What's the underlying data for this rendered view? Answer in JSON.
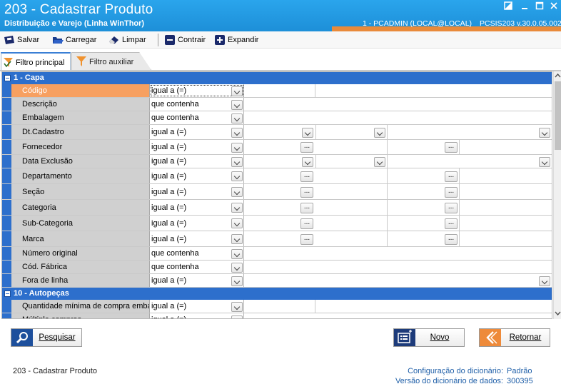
{
  "window": {
    "title": "203 - Cadastrar  Produto",
    "subtitle": "Distribuição e Varejo (Linha WinThor)",
    "user_info": "1 - PCADMIN (LOCAL@LOCAL)",
    "version": "PCSIS203  v.30.0.05.002",
    "accent_color": "#e98a3a",
    "bar_color": "#1d8fd8"
  },
  "toolbar": {
    "salvar": "Salvar",
    "carregar": "Carregar",
    "limpar": "Limpar",
    "contrair": "Contrair",
    "expandir": "Expandir"
  },
  "tabs": {
    "principal": "Filtro principal",
    "auxiliar": "Filtro auxiliar"
  },
  "sections": [
    {
      "title": "1 - Capa"
    },
    {
      "title": "10 - Autopeças"
    }
  ],
  "rows": [
    {
      "label": "Código",
      "operator": "igual a (=)"
    },
    {
      "label": "Descrição",
      "operator": "que contenha"
    },
    {
      "label": "Embalagem",
      "operator": "que contenha"
    },
    {
      "label": "Dt.Cadastro",
      "operator": "igual a (=)"
    },
    {
      "label": "Fornecedor",
      "operator": "igual a (=)"
    },
    {
      "label": "Data Exclusão",
      "operator": "igual a (=)"
    },
    {
      "label": "Departamento",
      "operator": "igual a (=)"
    },
    {
      "label": "Seção",
      "operator": "igual a (=)"
    },
    {
      "label": "Categoria",
      "operator": "igual a (=)"
    },
    {
      "label": "Sub-Categoria",
      "operator": "igual a (=)"
    },
    {
      "label": "Marca",
      "operator": "igual a (=)"
    },
    {
      "label": "Número original",
      "operator": "que contenha"
    },
    {
      "label": "Cód. Fábrica",
      "operator": "que contenha"
    },
    {
      "label": "Fora de linha",
      "operator": "igual a (=)"
    },
    {
      "label": "Quantidade mínima de compra embal",
      "operator": "igual a (=)"
    },
    {
      "label": "Múltiplo compras",
      "operator": "igual a (=)"
    }
  ],
  "ellipsis_glyph": "...",
  "buttons": {
    "pesquisar": "Pesquisar",
    "novo": "Novo",
    "retornar": "Retornar"
  },
  "footer": {
    "screen": "203 - Cadastrar  Produto",
    "dict_config_label": "Configuração do dicionário:",
    "dict_config_value": "Padrão",
    "dict_version_label": "Versão do dicionário de dados:",
    "dict_version_value": "300395"
  }
}
